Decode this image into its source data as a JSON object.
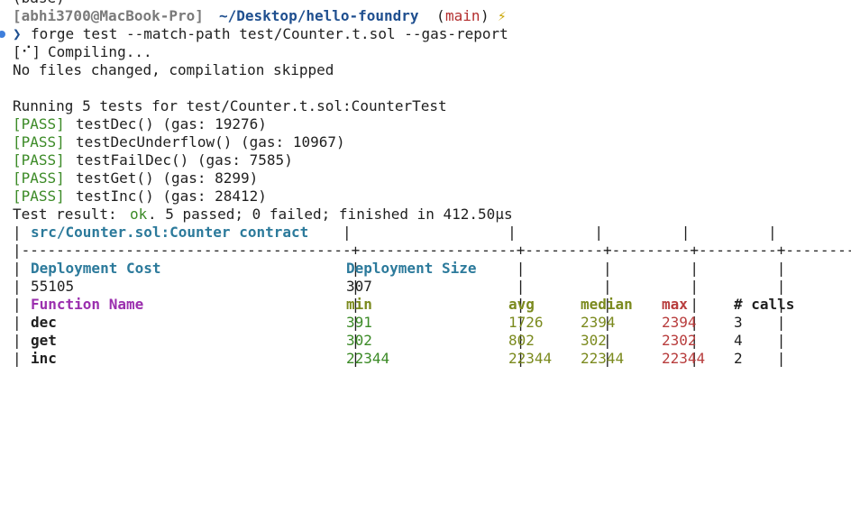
{
  "prev_line": "(base)",
  "prompt": {
    "user_host": "[abhi3700@MacBook-Pro]",
    "path": "~/Desktop/hello-foundry",
    "branch_open": "(",
    "branch": "main",
    "branch_close": ")",
    "dirty_marker": "⚡"
  },
  "command": {
    "arrow": "❯",
    "text": "forge test --match-path test/Counter.t.sol --gas-report"
  },
  "compile": {
    "spinner": "[⠊]",
    "compiling": "Compiling...",
    "skipped": "No files changed, compilation skipped"
  },
  "suite": "Running 5 tests for test/Counter.t.sol:CounterTest",
  "tests": [
    {
      "status": "[PASS]",
      "text": "testDec() (gas: 19276)"
    },
    {
      "status": "[PASS]",
      "text": "testDecUnderflow() (gas: 10967)"
    },
    {
      "status": "[PASS]",
      "text": "testFailDec() (gas: 7585)"
    },
    {
      "status": "[PASS]",
      "text": "testGet() (gas: 8299)"
    },
    {
      "status": "[PASS]",
      "text": "testInc() (gas: 28412)"
    }
  ],
  "result": {
    "prefix": "Test result: ",
    "ok": "ok",
    "rest": ". 5 passed; 0 failed; finished in 412.50µs"
  },
  "gas_report": {
    "contract": "src/Counter.sol:Counter contract",
    "deploy_cost_label": "Deployment Cost",
    "deploy_size_label": "Deployment Size",
    "deploy_cost": "55105",
    "deploy_size": "307",
    "headers": [
      "Function Name",
      "min",
      "avg",
      "median",
      "max",
      "# calls"
    ],
    "rows": [
      {
        "name": "dec",
        "min": "391",
        "avg": "1726",
        "median": "2394",
        "max": "2394",
        "calls": "3"
      },
      {
        "name": "get",
        "min": "302",
        "avg": "802",
        "median": "302",
        "max": "2302",
        "calls": "4"
      },
      {
        "name": "inc",
        "min": "22344",
        "avg": "22344",
        "median": "22344",
        "max": "22344",
        "calls": "2"
      }
    ]
  }
}
